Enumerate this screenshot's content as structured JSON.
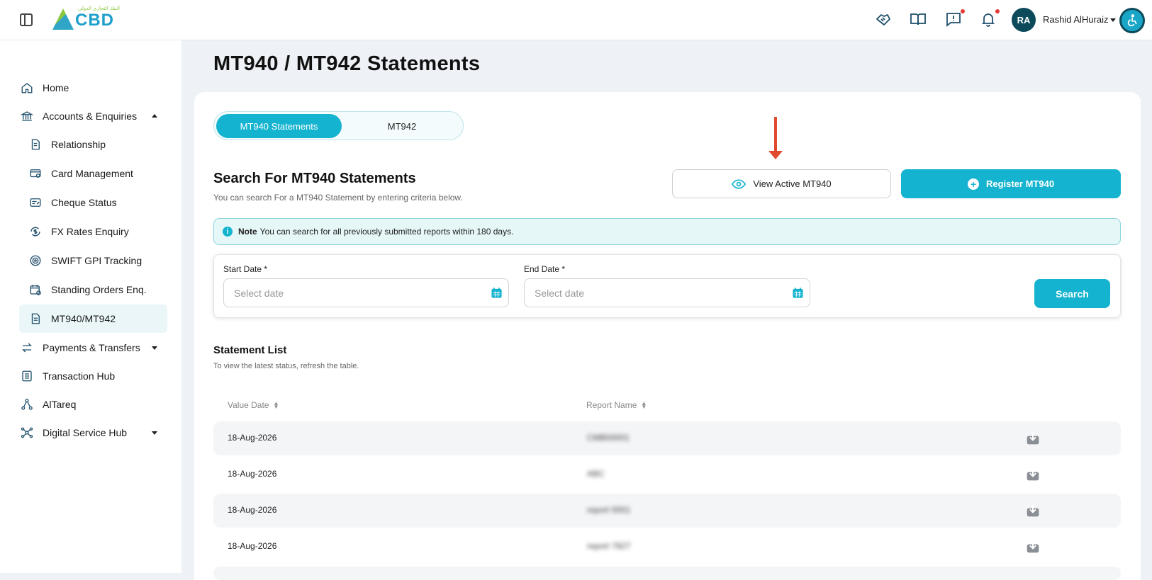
{
  "header": {
    "logo_text": "CBD",
    "logo_arabic": "البنك التجاري الدولي",
    "user_initials": "RA",
    "user_name": "Rashid AlHuraiz"
  },
  "sidebar": {
    "items": [
      {
        "label": "Home"
      },
      {
        "label": "Accounts & Enquiries"
      },
      {
        "label": "Relationship"
      },
      {
        "label": "Card Management"
      },
      {
        "label": "Cheque Status"
      },
      {
        "label": "FX Rates Enquiry"
      },
      {
        "label": "SWIFT GPI Tracking"
      },
      {
        "label": "Standing Orders Enq."
      },
      {
        "label": "MT940/MT942"
      },
      {
        "label": "Payments & Transfers"
      },
      {
        "label": "Transaction Hub"
      },
      {
        "label": "AlTareq"
      },
      {
        "label": "Digital Service Hub"
      }
    ]
  },
  "page": {
    "title": "MT940 / MT942 Statements"
  },
  "tabs": [
    {
      "label": "MT940 Statements"
    },
    {
      "label": "MT942"
    }
  ],
  "search": {
    "title": "Search For MT940 Statements",
    "subtitle": "You can search For a MT940 Statement by entering criteria below.",
    "view_active_label": "View Active MT940",
    "register_label": "Register MT940",
    "note_bold": "Note",
    "note_text": "You can search for all previously submitted reports within 180 days.",
    "start_label": "Start Date *",
    "end_label": "End Date *",
    "start_placeholder": "Select date",
    "end_placeholder": "Select date",
    "search_button": "Search"
  },
  "list": {
    "title": "Statement List",
    "subtitle": "To view the latest status, refresh the table.",
    "columns": [
      "Value Date",
      "Report Name"
    ],
    "rows": [
      {
        "date": "18-Aug-2026",
        "name": "CMB00001"
      },
      {
        "date": "18-Aug-2026",
        "name": "ABC"
      },
      {
        "date": "18-Aug-2026",
        "name": "report 0001"
      },
      {
        "date": "18-Aug-2026",
        "name": "report 7827"
      }
    ]
  },
  "colors": {
    "accent": "#14b3cf",
    "navy": "#0c4a5c",
    "annotation_arrow": "#e04a2e"
  }
}
